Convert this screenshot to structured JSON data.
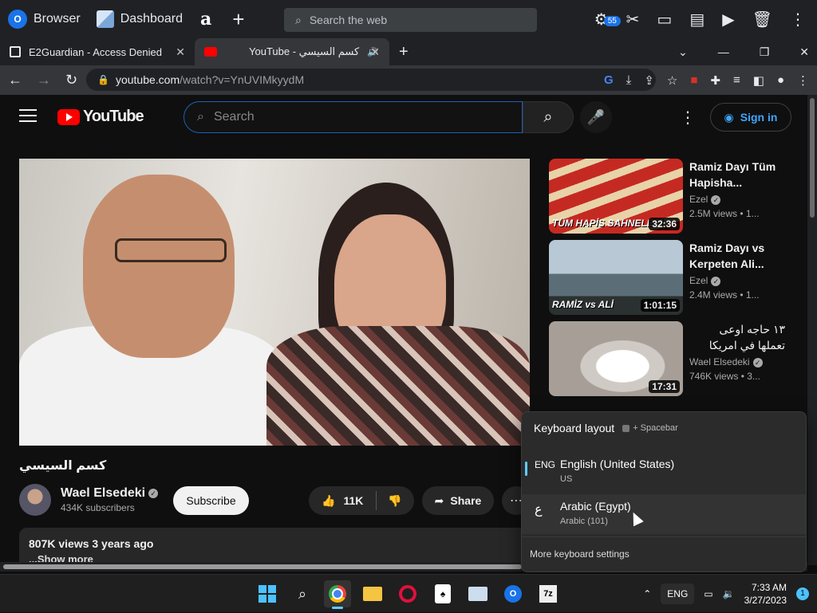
{
  "appbar": {
    "browser_label": "Browser",
    "dashboard_label": "Dashboard",
    "amazon_label": "a",
    "search_placeholder": "Search the web",
    "badge_count": "55"
  },
  "tabs": [
    {
      "title": "E2Guardian - Access Denied"
    },
    {
      "title": "YouTube - كسم السيسي"
    }
  ],
  "address": {
    "host": "youtube.com",
    "path": "/watch?v=YnUVIMkyydM"
  },
  "youtube": {
    "logo_text": "YouTube",
    "search_placeholder": "Search",
    "signin_label": "Sign in",
    "video_title": "كسم السيسي",
    "channel_name": "Wael Elsedeki",
    "subscribers": "434K subscribers",
    "subscribe_label": "Subscribe",
    "likes": "11K",
    "share_label": "Share",
    "views_line": "807K views  3 years ago",
    "desc_snippet": "...Show more"
  },
  "related": [
    {
      "title": "Ramiz Dayı Tüm Hapisha...",
      "channel": "Ezel",
      "meta": "2.5M views • 1...",
      "duration": "32:36",
      "thumb_text": "TÜM HAPİS SAHNELERİ"
    },
    {
      "title": "Ramiz Dayı vs Kerpeten Ali...",
      "channel": "Ezel",
      "meta": "2.4M views • 1...",
      "duration": "1:01:15",
      "thumb_text": "RAMİZ vs ALİ"
    },
    {
      "title": "١٣ حاجه اوعى تعملها في امريكا",
      "channel": "Wael Elsedeki",
      "meta": "746K views • 3...",
      "duration": "17:31",
      "thumb_text": ""
    }
  ],
  "keyboard_flyout": {
    "title": "Keyboard layout",
    "hint": "+ Spacebar",
    "options": [
      {
        "code": "ENG",
        "name": "English (United States)",
        "sub": "US"
      },
      {
        "code": "ع",
        "name": "Arabic (Egypt)",
        "sub": "Arabic (101)"
      }
    ],
    "more": "More keyboard settings"
  },
  "taskbar": {
    "lang": "ENG",
    "time": "7:33 AM",
    "date": "3/27/2023",
    "notifications": "1"
  },
  "colors": {
    "yt_red": "#ff0000",
    "link_blue": "#3ea6ff",
    "win_accent": "#4cc2ff"
  }
}
